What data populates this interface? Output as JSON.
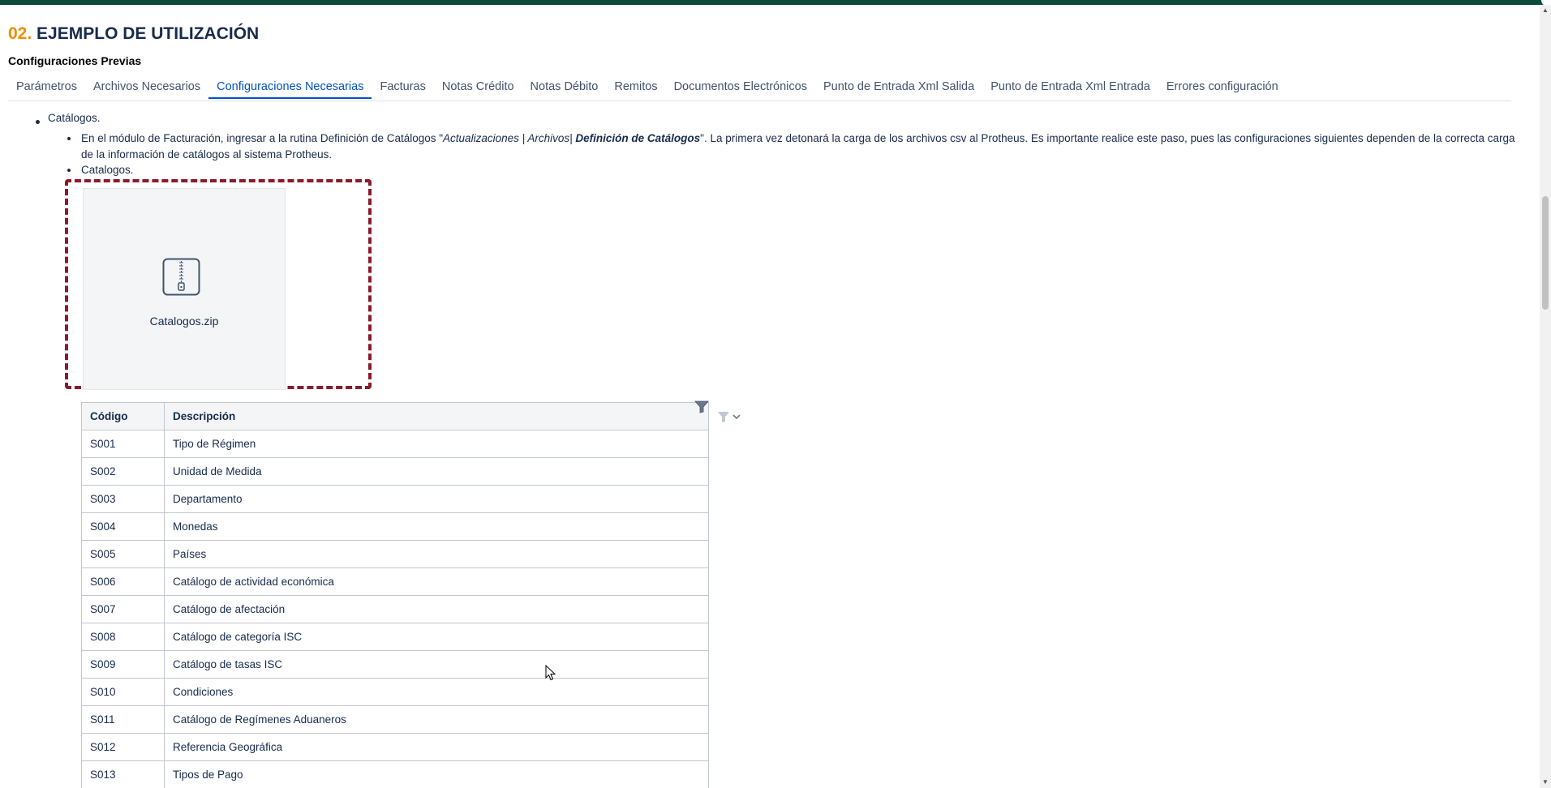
{
  "heading": {
    "number": "02.",
    "title": "EJEMPLO DE UTILIZACIÓN"
  },
  "subheading": "Configuraciones Previas",
  "tabs": [
    {
      "label": "Parámetros",
      "active": false
    },
    {
      "label": "Archivos Necesarios",
      "active": false
    },
    {
      "label": "Configuraciones Necesarias",
      "active": true
    },
    {
      "label": "Facturas",
      "active": false
    },
    {
      "label": "Notas Crédito",
      "active": false
    },
    {
      "label": "Notas Débito",
      "active": false
    },
    {
      "label": "Remitos",
      "active": false
    },
    {
      "label": "Documentos Electrónicos",
      "active": false
    },
    {
      "label": "Punto de Entrada Xml Salida",
      "active": false
    },
    {
      "label": "Punto de Entrada Xml Entrada",
      "active": false
    },
    {
      "label": "Errores configuración",
      "active": false
    }
  ],
  "content": {
    "bullet_main": "Catálogos.",
    "para_part1": "En el módulo de Facturación, ingresar a la rutina Definición de Catálogos  \"",
    "para_italic": "Actualizaciones | Archivos| ",
    "para_bold_italic": "Definición de Catálogos",
    "para_part2": "\". La primera vez detonará la carga de los archivos csv al Protheus. Es importante realice este paso, pues las configuraciones siguientes dependen de la correcta carga de la información de catálogos al sistema Protheus.",
    "bullet_sub2": "Catalogos.",
    "attachment": {
      "filename": "Catalogos.zip",
      "icon": "zip-file-icon"
    }
  },
  "table": {
    "headers": [
      "Código",
      "Descripción"
    ],
    "rows": [
      [
        "S001",
        "Tipo de Régimen"
      ],
      [
        "S002",
        "Unidad de Medida"
      ],
      [
        "S003",
        "Departamento"
      ],
      [
        "S004",
        "Monedas"
      ],
      [
        "S005",
        "Países"
      ],
      [
        "S006",
        "Catálogo de actividad económica"
      ],
      [
        "S007",
        "Catálogo de afectación"
      ],
      [
        "S008",
        "Catálogo de categoría ISC"
      ],
      [
        "S009",
        "Catálogo de tasas ISC"
      ],
      [
        "S010",
        "Condiciones"
      ],
      [
        "S011",
        "Catálogo de Regímenes Aduaneros"
      ],
      [
        "S012",
        "Referencia Geográfica"
      ],
      [
        "S013",
        "Tipos de Pago"
      ]
    ]
  },
  "colors": {
    "accent_number": "#f38b00",
    "active_tab": "#0052cc",
    "frame_border": "#8b1a2b",
    "topbar": "#0b4a3a"
  }
}
